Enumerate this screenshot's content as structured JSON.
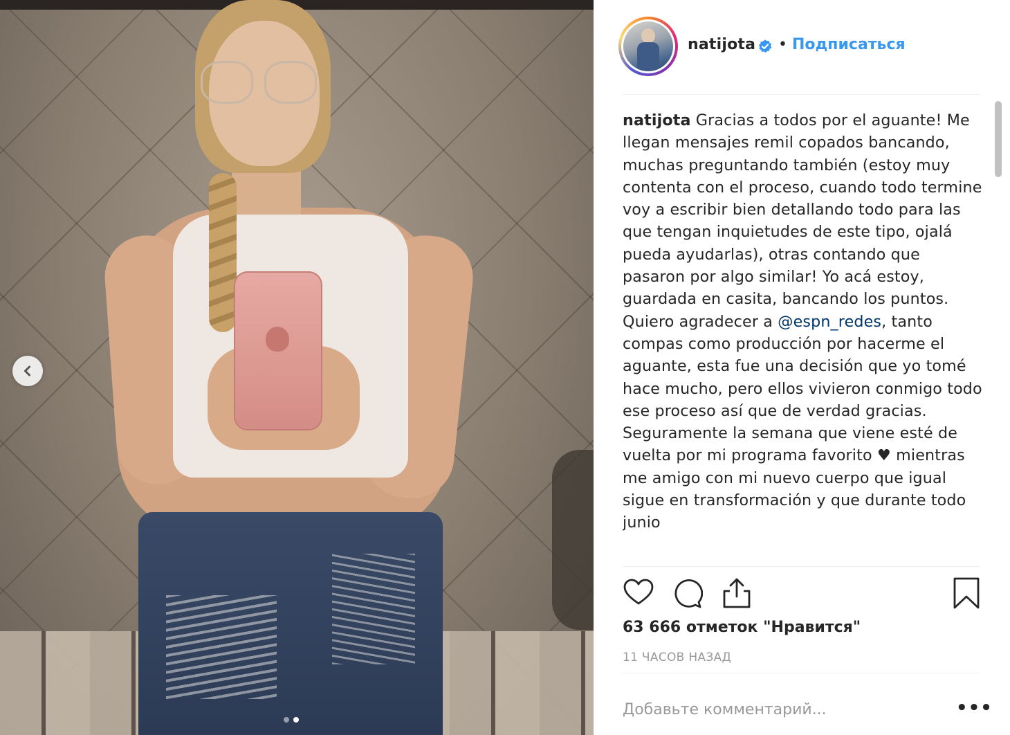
{
  "post": {
    "username": "natijota",
    "separator": "•",
    "follow_label": "Подписаться",
    "caption_username": "natijota",
    "caption_part1": " Gracias a todos por el aguante! Me llegan mensajes remil copados bancando, muchas preguntando también (estoy muy contenta con el proceso, cuando todo termine voy a escribir bien detallando todo para las que tengan inquietudes de este tipo, ojalá pueda ayudarlas), otras contando que pasaron por algo similar! Yo acá estoy, guardada en casita, bancando los puntos. Quiero agradecer a ",
    "caption_mention": "@espn_redes",
    "caption_part2": ", tanto compas como producción por hacerme el aguante, esta fue una decisión que yo tomé hace mucho, pero ellos vivieron conmigo todo ese proceso así que de verdad gracias. Seguramente la semana que viene esté de vuelta por mi programa favorito ♥ mientras me amigo con mi nuevo cuerpo que igual sigue en transformación y que durante todo junio",
    "likes_text": "63 666 отметок \"Нравится\"",
    "time_text": "11 ЧАСОВ НАЗАД",
    "comment_placeholder": "Добавьте комментарий...",
    "more_label": "•••"
  },
  "carousel": {
    "slide_count": 2,
    "active_slide": 2
  },
  "icons": {
    "prev": "chevron-left-icon",
    "verified": "verified-badge-icon",
    "like": "heart-icon",
    "comment": "comment-icon",
    "share": "share-icon",
    "save": "bookmark-icon"
  },
  "colors": {
    "link_blue": "#3897f0",
    "mention_blue": "#003569",
    "text": "#262626",
    "muted": "#999999"
  }
}
